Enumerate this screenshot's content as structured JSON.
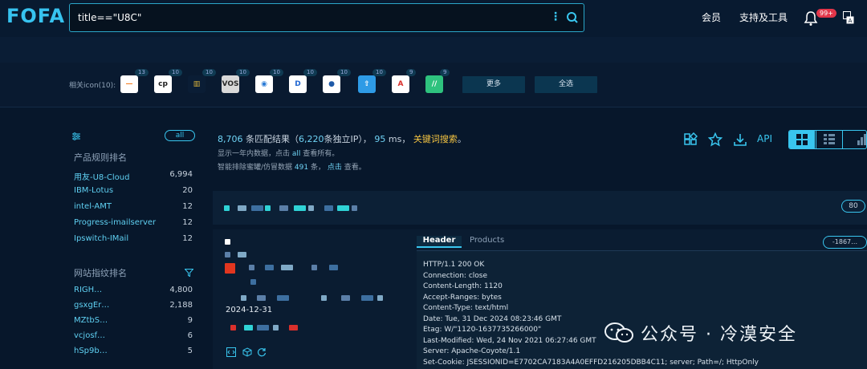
{
  "brand": {
    "logo": "FOFA"
  },
  "search": {
    "query": "title==\"U8C\""
  },
  "nav": {
    "member": "会员",
    "support": "支持及工具",
    "notif_badge": "99+"
  },
  "related": {
    "label": "相关icon(10):",
    "icons": [
      {
        "count": "13",
        "glyph": "—",
        "bg": "#ffffff",
        "fg": "#f5832a"
      },
      {
        "count": "10",
        "glyph": "cp",
        "bg": "#ffffff",
        "fg": "#1a1a1a"
      },
      {
        "count": "10",
        "glyph": "▥",
        "bg": "#0a1d35",
        "fg": "#d9b23a"
      },
      {
        "count": "10",
        "glyph": "VOS",
        "bg": "#d9d9d9",
        "fg": "#2a2a2a"
      },
      {
        "count": "10",
        "glyph": "◉",
        "bg": "#ffffff",
        "fg": "#2a7bd6"
      },
      {
        "count": "10",
        "glyph": "D",
        "bg": "#ffffff",
        "fg": "#1f66d1"
      },
      {
        "count": "10",
        "glyph": "●",
        "bg": "#ffffff",
        "fg": "#1f5aa8"
      },
      {
        "count": "10",
        "glyph": "⇧",
        "bg": "#2e9be6",
        "fg": "#ffffff"
      },
      {
        "count": "9",
        "glyph": "A",
        "bg": "#ffffff",
        "fg": "#d9302c"
      },
      {
        "count": "9",
        "glyph": "//",
        "bg": "#2ec27e",
        "fg": "#ffffff"
      }
    ],
    "more": "更多",
    "select_all": "全选"
  },
  "sidebar": {
    "all": "all",
    "product_heading": "产品规则排名",
    "products": [
      {
        "name": "用友-U8-Cloud",
        "count": "6,994"
      },
      {
        "name": "IBM-Lotus",
        "count": "20"
      },
      {
        "name": "intel-AMT",
        "count": "12"
      },
      {
        "name": "Progress-imailserver",
        "count": "12"
      },
      {
        "name": "Ipswitch-IMail",
        "count": "12"
      }
    ],
    "fingerprint_heading": "网站指纹排名",
    "fingerprints": [
      {
        "name": "RIGH…",
        "count": "4,800"
      },
      {
        "name": "gsxgEr…",
        "count": "2,188"
      },
      {
        "name": "MZtbS…",
        "count": "9"
      },
      {
        "name": "vcjosf…",
        "count": "6"
      },
      {
        "name": "hSp9b…",
        "count": "5"
      }
    ]
  },
  "results": {
    "total": "8,706",
    "label_total": "条匹配结果（",
    "unique_ip": "6,220",
    "label_ip": "条独立IP），",
    "ms": "95",
    "label_ms": "ms，",
    "keyword": "关键词搜索",
    "end": "。",
    "line2_a": "显示一年内数据，点击",
    "line2_all": "all",
    "line2_b": "查看所有。",
    "line3_a": "智能排除蜜罐/仿冒数据",
    "line3_count": "491",
    "line3_b": "条，",
    "line3_click": "点击",
    "line3_c": "查看。",
    "api": "API"
  },
  "result_item": {
    "port": "80",
    "date": "2024-12-31",
    "tab_header": "Header",
    "tab_products": "Products",
    "hash": "-1867…",
    "header_lines": [
      "HTTP/1.1 200 OK",
      "Connection: close",
      "Content-Length: 1120",
      "Accept-Ranges: bytes",
      "Content-Type: text/html",
      "Date: Tue, 31 Dec 2024 08:23:46 GMT",
      "Etag: W/\"1120-1637735266000\"",
      "Last-Modified: Wed, 24 Nov 2021 06:27:46 GMT",
      "Server: Apache-Coyote/1.1",
      "Set-Cookie: JSESSIONID=E7702CA7183A4A0EFFD216205DBB4C11; server; Path=/; HttpOnly"
    ]
  },
  "watermark": {
    "text": "公众号 · 冷漠安全"
  },
  "colors": {
    "accent": "#39c6ef",
    "background": "#07172b",
    "keyword": "#f5c542"
  }
}
